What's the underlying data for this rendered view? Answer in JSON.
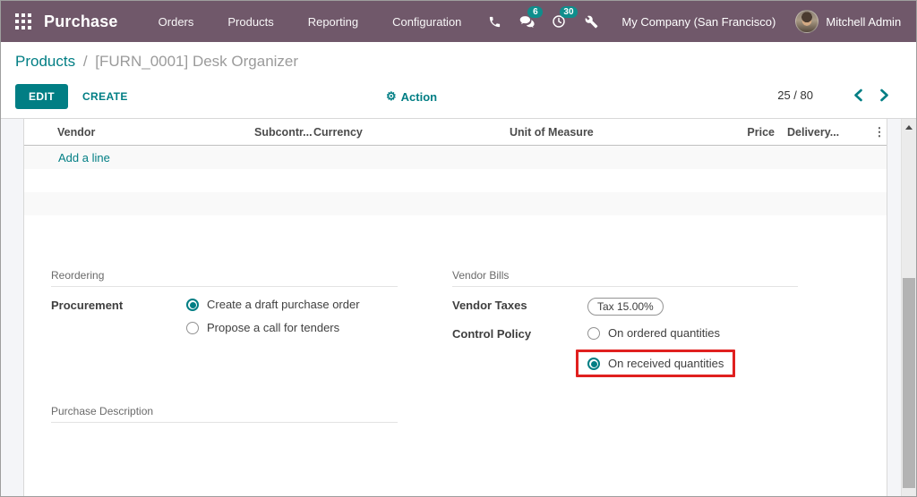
{
  "colors": {
    "navbar": "#70586A",
    "accent": "#017e84",
    "badge": "#0f8e8c",
    "highlight": "#e0201f"
  },
  "navbar": {
    "brand": "Purchase",
    "menu": [
      "Orders",
      "Products",
      "Reporting",
      "Configuration"
    ],
    "badges": {
      "messages": "6",
      "activities": "30"
    },
    "company": "My Company (San Francisco)",
    "user": "Mitchell Admin"
  },
  "breadcrumb": {
    "parent": "Products",
    "separator": "/",
    "current": "[FURN_0001] Desk Organizer"
  },
  "control_panel": {
    "edit": "EDIT",
    "create": "CREATE",
    "action": "Action",
    "gear_glyph": "⚙",
    "pager": "25 / 80"
  },
  "table": {
    "columns": [
      "Vendor",
      "Subcontr...",
      "Currency",
      "Unit of Measure",
      "Price",
      "Delivery..."
    ],
    "options_glyph": "⋮",
    "add_line": "Add a line"
  },
  "sections": {
    "reordering": {
      "title": "Reordering",
      "procurement_label": "Procurement",
      "options": [
        "Create a draft purchase order",
        "Propose a call for tenders"
      ],
      "selected": 0
    },
    "vendor_bills": {
      "title": "Vendor Bills",
      "vendor_taxes_label": "Vendor Taxes",
      "tax_tag": "Tax 15.00%",
      "control_policy_label": "Control Policy",
      "options": [
        "On ordered quantities",
        "On received quantities"
      ],
      "selected": 1
    },
    "purchase_description": {
      "title": "Purchase Description"
    }
  }
}
